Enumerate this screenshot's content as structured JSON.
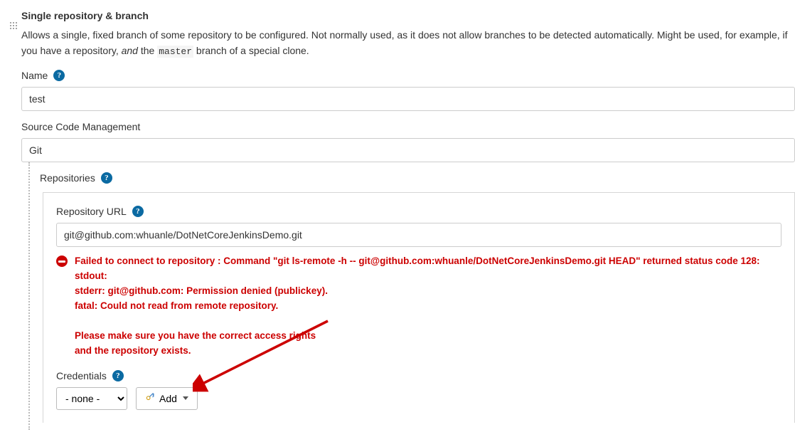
{
  "section": {
    "title": "Single repository & branch",
    "description_before": "Allows a single, fixed branch of some repository to be configured. Not normally used, as it does not allow branches to be detected automatically. Might be used, for example, if you have a repository, ",
    "description_and": "and",
    "description_the": " the ",
    "description_code": "master",
    "description_after": " branch of a special clone."
  },
  "name": {
    "label": "Name",
    "value": "test"
  },
  "scm": {
    "label": "Source Code Management",
    "value": "Git"
  },
  "repositories": {
    "label": "Repositories"
  },
  "repo_url": {
    "label": "Repository URL",
    "value": "git@github.com:whuanle/DotNetCoreJenkinsDemo.git"
  },
  "error": {
    "text": "Failed to connect to repository : Command \"git ls-remote -h -- git@github.com:whuanle/DotNetCoreJenkinsDemo.git HEAD\" returned status code 128:\nstdout:\nstderr: git@github.com: Permission denied (publickey).\nfatal: Could not read from remote repository.\n\nPlease make sure you have the correct access rights\nand the repository exists."
  },
  "credentials": {
    "label": "Credentials",
    "selected": "- none -",
    "add_label": "Add"
  }
}
